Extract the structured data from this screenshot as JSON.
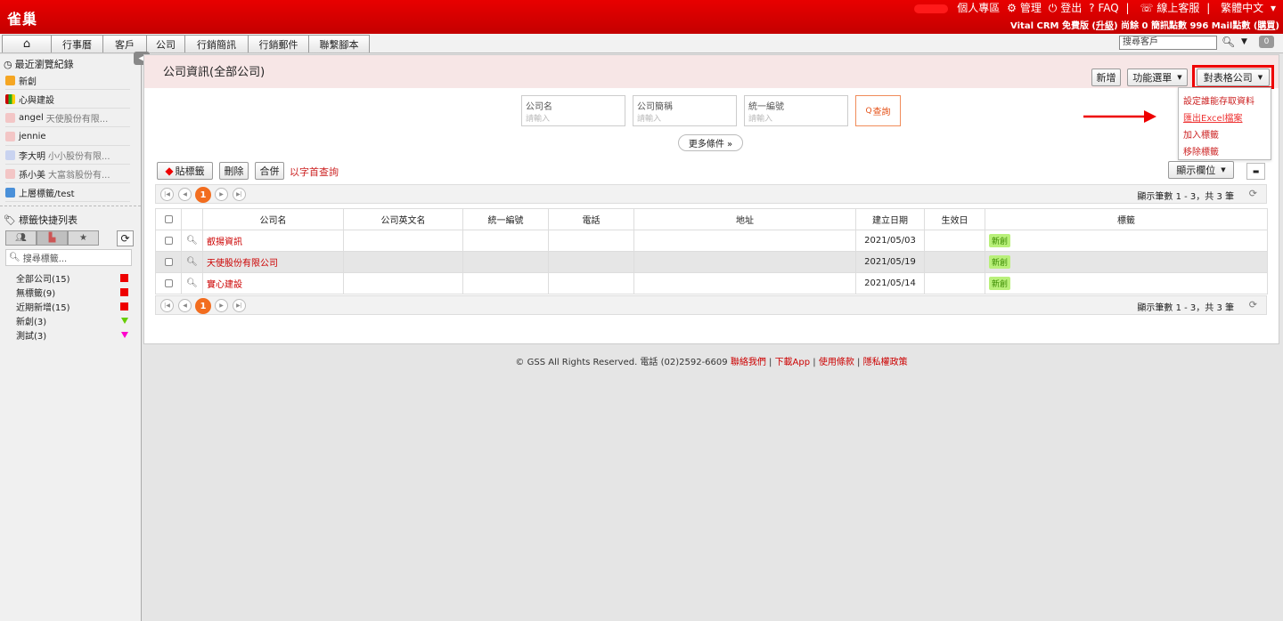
{
  "app": {
    "logo": "雀巢",
    "top_links": [
      "個人專區",
      "管理",
      "登出",
      "FAQ",
      "線上客服",
      "繁體中文"
    ],
    "sub_info_prefix": "Vital CRM 免費版 (",
    "sub_info_upgrade": "升級",
    "sub_info_mid": ") 尚餘 0 簡訊點數 996 Mail點數 (",
    "sub_info_buy": "購買",
    "sub_info_end": ")"
  },
  "nav": {
    "items": [
      "行事曆",
      "客戶",
      "公司",
      "行銷簡訊",
      "行銷郵件",
      "聯繫腳本"
    ],
    "search_value": "搜尋客戶",
    "badge": "0"
  },
  "sidebar": {
    "recent_title": "最近瀏覽紀錄",
    "recent": [
      {
        "name": "新創",
        "sub": ""
      },
      {
        "name": "心與建設",
        "sub": ""
      },
      {
        "name": "angel",
        "sub": "天使股份有限..."
      },
      {
        "name": "jennie",
        "sub": ""
      },
      {
        "name": "李大明",
        "sub": "小小股份有限..."
      },
      {
        "name": "孫小美",
        "sub": "大富翁股份有..."
      },
      {
        "name": "上層標籤/test",
        "sub": ""
      }
    ],
    "tag_title": "標籤快捷列表",
    "tag_search_placeholder": "搜尋標籤...",
    "tags": [
      {
        "label": "全部公司(15)",
        "color": "#ee0000",
        "shape": "square"
      },
      {
        "label": "無標籤(9)",
        "color": "#ee0000",
        "shape": "square"
      },
      {
        "label": "近期新增(15)",
        "color": "#ee0000",
        "shape": "square"
      },
      {
        "label": "新創(3)",
        "color": "#66cc00",
        "shape": "triangle"
      },
      {
        "label": "測試(3)",
        "color": "#ff00cc",
        "shape": "triangle"
      }
    ]
  },
  "main": {
    "title": "公司資訊(全部公司)",
    "buttons": {
      "new": "新增",
      "func_menu": "功能選單",
      "table_company": "對表格公司"
    },
    "dropdown": [
      "設定誰能存取資料",
      "匯出Excel檔案",
      "加入標籤",
      "移除標籤"
    ],
    "filters": [
      {
        "label": "公司名",
        "placeholder": "請輸入"
      },
      {
        "label": "公司簡稱",
        "placeholder": "請輸入"
      },
      {
        "label": "統一編號",
        "placeholder": "請輸入"
      }
    ],
    "query_label": "查詢",
    "more_label": "更多條件 »",
    "actions": {
      "tag": "貼標籤",
      "delete": "刪除",
      "merge": "合併",
      "alpha": "以字首查詢"
    },
    "show_cols": "顯示欄位",
    "pager": {
      "current": "1",
      "info": "顯示筆數 1 - 3，共 3 筆"
    },
    "columns": [
      "公司名",
      "公司英文名",
      "統一編號",
      "電話",
      "地址",
      "建立日期",
      "生效日",
      "標籤"
    ],
    "rows": [
      {
        "name": "叡揚資訊",
        "en": "",
        "tax": "",
        "tel": "",
        "addr": "",
        "created": "2021/05/03",
        "eff": "",
        "tag": "新創"
      },
      {
        "name": "天使股份有限公司",
        "en": "",
        "tax": "",
        "tel": "",
        "addr": "",
        "created": "2021/05/19",
        "eff": "",
        "tag": "新創"
      },
      {
        "name": "實心建設",
        "en": "",
        "tax": "",
        "tel": "",
        "addr": "",
        "created": "2021/05/14",
        "eff": "",
        "tag": "新創"
      }
    ]
  },
  "footer": {
    "copyright": "© GSS All Rights Reserved. 電話 (02)2592-6609",
    "links": [
      "聯絡我們",
      "下載App",
      "使用條款",
      "隱私權政策"
    ]
  },
  "colors": {
    "brand": "#d40000",
    "accent": "#f26d1f",
    "highlight": "#ee0000"
  }
}
